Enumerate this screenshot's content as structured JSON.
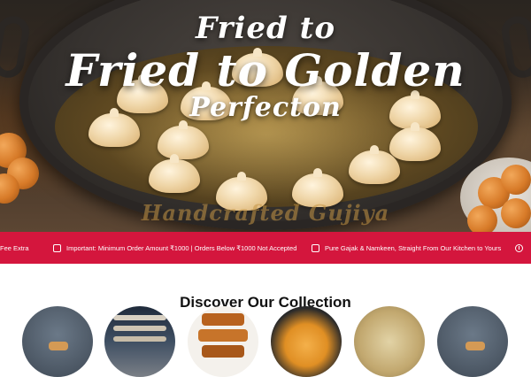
{
  "hero": {
    "line1": "Fried to",
    "line2": "Fried to Golden",
    "line3": "Perfecton",
    "watermark": "Handcrafted Gujiya"
  },
  "announcement_bar": {
    "background": "#d4163d",
    "items": [
      {
        "icon": "delivery-icon",
        "text": "Fee Extra"
      },
      {
        "icon": "info-box-icon",
        "text": "Important: Minimum Order Amount ₹1000 | Orders Below ₹1000 Not Accepted"
      },
      {
        "icon": "home-kitchen-icon",
        "text": "Pure Gajak & Namkeen, Straight From Our Kitchen to Yours"
      },
      {
        "icon": "delivery-icon",
        "text": ""
      }
    ]
  },
  "collection": {
    "title": "Discover Our Collection",
    "items": [
      {
        "icon": "gujiya-product-image"
      },
      {
        "icon": "store-shelves-image"
      },
      {
        "icon": "gajak-bars-image"
      },
      {
        "icon": "sweet-bowl-image"
      },
      {
        "icon": "namkeen-mix-image"
      },
      {
        "icon": "gujiya-product-image"
      }
    ]
  }
}
